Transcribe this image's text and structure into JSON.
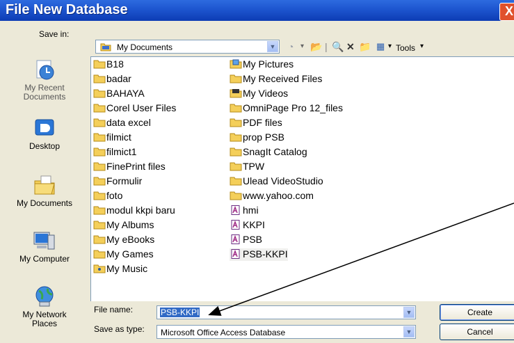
{
  "window": {
    "title": "File New Database",
    "close_label": "X"
  },
  "toolbar": {
    "save_in_label": "Save in:",
    "location": "My Documents",
    "tools_label": "Tools"
  },
  "places": [
    {
      "label": "My Recent\nDocuments",
      "icon": "recent-documents-icon"
    },
    {
      "label": "Desktop",
      "icon": "desktop-icon"
    },
    {
      "label": "My Documents",
      "icon": "my-documents-icon"
    },
    {
      "label": "My Computer",
      "icon": "my-computer-icon"
    },
    {
      "label": "My Network\nPlaces",
      "icon": "network-places-icon"
    }
  ],
  "files": {
    "column1": [
      "B18",
      "badar",
      "BAHAYA",
      "Corel User Files",
      "data excel",
      "filmict",
      "filmict1",
      "FinePrint files",
      "Formulir",
      "foto",
      "modul kkpi baru",
      "My Albums",
      "My eBooks",
      "My Games",
      "My Music"
    ],
    "column2": [
      "My Pictures",
      "My Received Files",
      "My Videos",
      "OmniPage Pro 12_files",
      "PDF files",
      "prop PSB",
      "SnagIt Catalog",
      "TPW",
      "Ulead VideoStudio",
      "www.yahoo.com",
      "hmi",
      "KKPI",
      "PSB",
      "PSB-KKPI"
    ],
    "selected": "PSB-KKPI"
  },
  "form": {
    "file_name_label": "File name:",
    "file_name_value": "PSB-KKPI",
    "save_as_type_label": "Save as type:",
    "save_as_type_value": "Microsoft Office Access Database",
    "create_label": "Create",
    "cancel_label": "Cancel"
  }
}
